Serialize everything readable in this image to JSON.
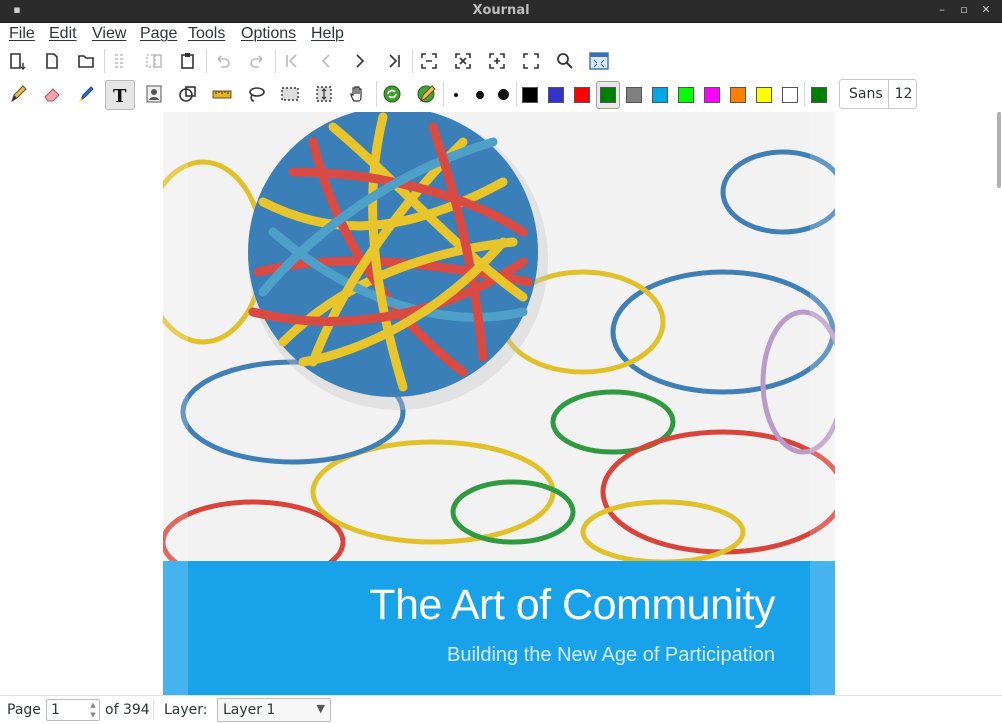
{
  "window": {
    "title": "Xournal"
  },
  "menu": [
    "File",
    "Edit",
    "View",
    "Page",
    "Tools",
    "Options",
    "Help"
  ],
  "toolbar_top": [
    "new-page-icon",
    "open-file-icon",
    "open-folder-icon",
    "cut-icon",
    "copy-icon",
    "paste-icon",
    "undo-icon",
    "redo-icon",
    "first-page-icon",
    "previous-page-icon",
    "next-page-icon",
    "last-page-icon",
    "zoom-fit-icon",
    "zoom-out-icon",
    "zoom-in-icon",
    "zoom-page-width-icon",
    "find-icon",
    "fullscreen-icon"
  ],
  "toolbar_tools": [
    "pen-icon",
    "eraser-icon",
    "highlighter-icon",
    "text-icon",
    "image-icon",
    "shape-recognizer-icon",
    "ruler-icon",
    "lasso-icon",
    "rect-select-icon",
    "vertical-space-icon",
    "hand-icon",
    "default-tool-icon",
    "default-pen-icon"
  ],
  "pen_sizes": [
    "fine",
    "medium",
    "thick"
  ],
  "colors": {
    "palette": [
      "#000000",
      "#3333cc",
      "#ff0000",
      "#008000",
      "#808080",
      "#00a8e8",
      "#00ff00",
      "#ff00ff",
      "#ff8000",
      "#ffff00",
      "#ffffff"
    ],
    "selected": "#008000",
    "current": "#008000"
  },
  "font": {
    "name": "Sans",
    "size": "12"
  },
  "document": {
    "title": "The Art of Community",
    "subtitle": "Building the New Age of Participation",
    "banner_color": "#17a2ea"
  },
  "status": {
    "page_label": "Page",
    "page_value": "1",
    "page_total": "of 394",
    "layer_label": "Layer:",
    "layer_value": "Layer 1"
  }
}
